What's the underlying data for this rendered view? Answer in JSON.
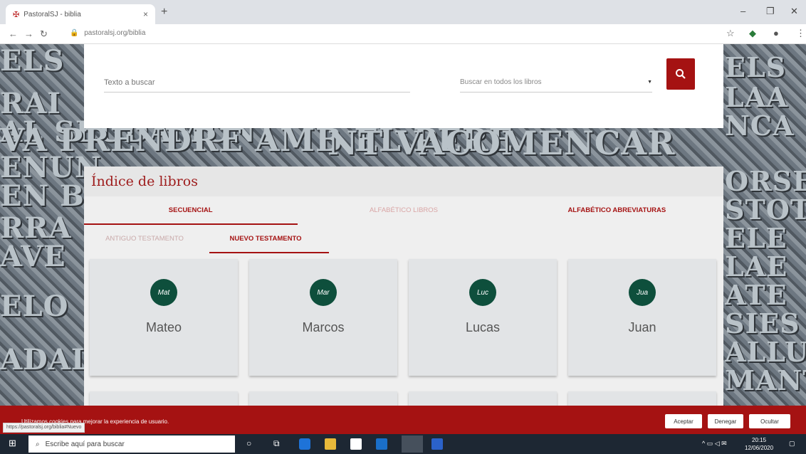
{
  "browser": {
    "tab_title": "PastoralSJ - biblia",
    "url": "pastoralsj.org/biblia"
  },
  "background_words": [
    "ELS",
    "RAI",
    "AL SEUDAMUNT",
    "VA PRENDRE AMB EL PERE",
    "NT VACOMENCAR",
    "ENUN",
    "ELS",
    "LAA",
    "NCA",
    "ORSE",
    "STOT",
    "ELE",
    "LAE",
    "ATE",
    "SIES",
    "ALLU",
    "MANT",
    "EN B",
    "RRA",
    "AVE",
    "ELO",
    "ADAL"
  ],
  "search": {
    "placeholder": "Texto a buscar",
    "scope": "Buscar en todos los libros"
  },
  "index": {
    "title": "Índice de libros",
    "tabs": [
      "SECUENCIAL",
      "ALFABÉTICO LIBROS",
      "ALFABÉTICO ABREVIATURAS"
    ],
    "subtabs": [
      "ANTIGUO TESTAMENTO",
      "NUEVO TESTAMENTO"
    ],
    "books": [
      {
        "abbr": "Mat",
        "name": "Mateo"
      },
      {
        "abbr": "Mar",
        "name": "Marcos"
      },
      {
        "abbr": "Luc",
        "name": "Lucas"
      },
      {
        "abbr": "Jua",
        "name": "Juan"
      }
    ]
  },
  "cookie": {
    "message": "Utilizamos cookies para mejorar la experiencia de usuario.",
    "accept": "Aceptar",
    "deny": "Denegar",
    "hide": "Ocultar"
  },
  "status_url": "https://pastoralsj.org/biblia#Nuevo",
  "taskbar": {
    "search_placeholder": "Escribe aquí para buscar",
    "time": "20:15",
    "date": "12/06/2020"
  },
  "colors": {
    "accent": "#a51212",
    "book_circle": "#0e4f3c"
  }
}
